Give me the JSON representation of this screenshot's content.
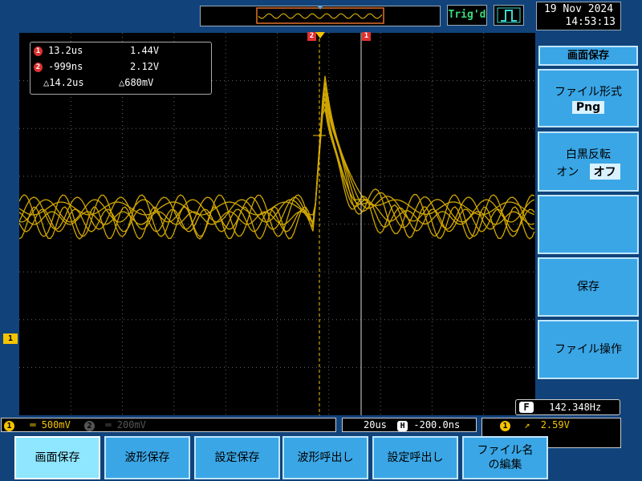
{
  "top": {
    "trigger_status": "Trig'd",
    "clock_date": "19 Nov 2024",
    "clock_time": "14:53:13"
  },
  "cursors": {
    "row1": {
      "badge": "1",
      "time": "13.2us",
      "volt": "1.44V"
    },
    "row2": {
      "badge": "2",
      "time": "-999ns",
      "volt": "2.12V"
    },
    "delta": {
      "time": "△14.2us",
      "volt": "△680mV"
    }
  },
  "markers": {
    "cursor2": "2",
    "cursor1": "1",
    "ch1": "1"
  },
  "menu": {
    "title": "画面保存",
    "file_format_label": "ファイル形式",
    "file_format_value": "Png",
    "invert_label": "白黒反転",
    "invert_on": "オン",
    "invert_off": "オフ",
    "save_label": "保存",
    "file_ops_label": "ファイル操作"
  },
  "status": {
    "freq_badge": "F",
    "frequency": "142.348Hz",
    "ch1_badge": "1",
    "ch1_scale": "500mV",
    "ch2_badge": "2",
    "ch2_scale": "200mV",
    "timebase": "20us",
    "h_badge": "H",
    "h_position": "-200.0ns",
    "trig_badge": "1",
    "trig_level": "2.59V"
  },
  "bottom_buttons": [
    "画面保存",
    "波形保存",
    "設定保存",
    "波形呼出し",
    "設定呼出し",
    "ファイル名\nの編集"
  ],
  "colors": {
    "ch1": "#f5c400",
    "accent": "#3aa6e6",
    "background": "#11437a",
    "cursor_marker": "#e03030"
  }
}
